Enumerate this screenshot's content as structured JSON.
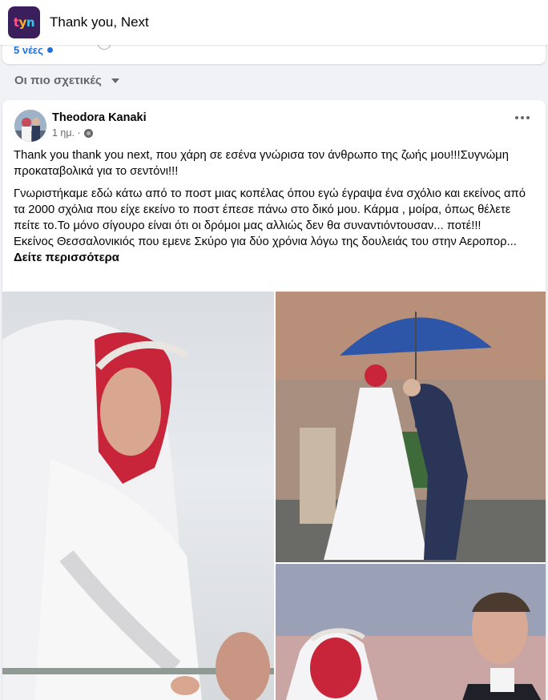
{
  "header": {
    "group_logo_text": [
      "t",
      "y",
      "n"
    ],
    "group_name": "Thank you, Next"
  },
  "previous_post": {
    "new_comments_label": "5 νέες"
  },
  "sort": {
    "label": "Οι πιο σχετικές"
  },
  "post": {
    "author": "Theodora Kanaki",
    "time": "1 ημ. ·",
    "paragraphs": [
      "Thank you thank you next, που χάρη σε εσένα γνώρισα τον άνθρωπο της ζωής μου!!!Συγνώμη προκαταβολικά για το σεντόνι!!!",
      "Γνωριστήκαμε εδώ κάτω από το ποστ μιας κοπέλας όπου εγώ έγραψα ένα σχόλιο και εκείνος από τα 2000 σχόλια που είχε εκείνο το ποστ έπεσε πάνω στο δικό μου. Κάρμα , μοίρα, όπως θέλετε πείτε το.Το μόνο σίγουρο είναι ότι οι δρόμοι μας αλλιώς δεν θα συναντιόντουσαν... ποτέ!!!",
      "Εκείνος  Θεσσαλονικιός που εμενε Σκύρο για δύο χρόνια λόγω της δουλειάς του  στην Αεροπορ..."
    ],
    "see_more_label": "Δείτε περισσότερα"
  },
  "colors": {
    "link_blue": "#216fdb",
    "secondary_text": "#65676b",
    "logo_background": "#3b1f5c"
  },
  "icons": [
    "group-logo",
    "blue-dot-icon",
    "caret-down-icon",
    "globe-icon",
    "more-options-icon"
  ]
}
